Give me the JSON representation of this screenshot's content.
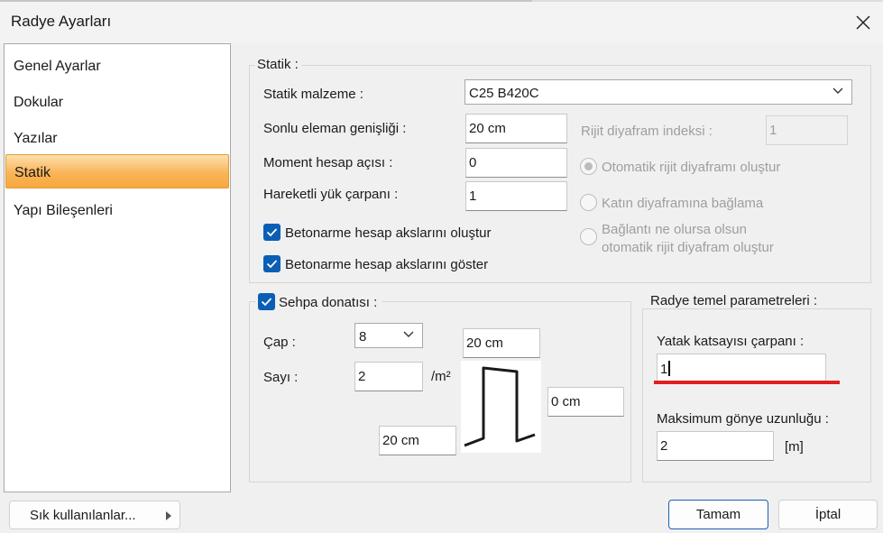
{
  "window": {
    "title": "Radye Ayarları"
  },
  "sidebar": {
    "items": [
      {
        "label": "Genel Ayarlar"
      },
      {
        "label": "Dokular"
      },
      {
        "label": "Yazılar"
      },
      {
        "label": "Statik",
        "selected": true
      },
      {
        "label": "Yapı Bileşenleri"
      }
    ]
  },
  "statik": {
    "legend": "Statik :",
    "material_label": "Statik malzeme :",
    "material_value": "C25 B420C",
    "fe_width_label": "Sonlu eleman genişliği :",
    "fe_width_value": "20 cm",
    "moment_label": "Moment hesap açısı :",
    "moment_value": "0",
    "live_load_label": "Hareketli yük çarpanı :",
    "live_load_value": "1",
    "axes_create_label": "Betonarme hesap akslarını oluştur",
    "axes_show_label": "Betonarme hesap akslarını göster",
    "rigid_index_label": "Rijit diyafram indeksi :",
    "rigid_index_value": "1",
    "radio_auto": "Otomatik rijit diyaframı oluştur",
    "radio_floor": "Katın diyaframına bağlama",
    "radio_any_line1": "Bağlantı ne olursa olsun",
    "radio_any_line2": "otomatik rijit diyafram oluştur"
  },
  "sehpa": {
    "legend": "Sehpa donatısı :",
    "diameter_label": "Çap :",
    "diameter_value": "8",
    "count_label": "Sayı :",
    "count_value": "2",
    "count_unit": "/m²",
    "top_value": "20 cm",
    "right_value": "0 cm",
    "bottom_value": "20 cm"
  },
  "radye": {
    "legend": "Radye temel parametreleri :",
    "bed_coeff_label": "Yatak katsayısı çarpanı :",
    "bed_coeff_value": "1",
    "max_length_label": "Maksimum gönye uzunluğu :",
    "max_length_value": "2",
    "max_length_unit": "[m]"
  },
  "footer": {
    "favorites_label": "Sık kullanılanlar...",
    "ok_label": "Tamam",
    "cancel_label": "İptal"
  },
  "colors": {
    "check_blue": "#0a5fb5",
    "selected_orange": "#f9b458",
    "underline_red": "#e02020"
  },
  "icons": {
    "close": "close-icon",
    "dropdown": "chevron-down-icon",
    "submenu": "triangle-right-icon",
    "check": "checkmark-icon"
  }
}
